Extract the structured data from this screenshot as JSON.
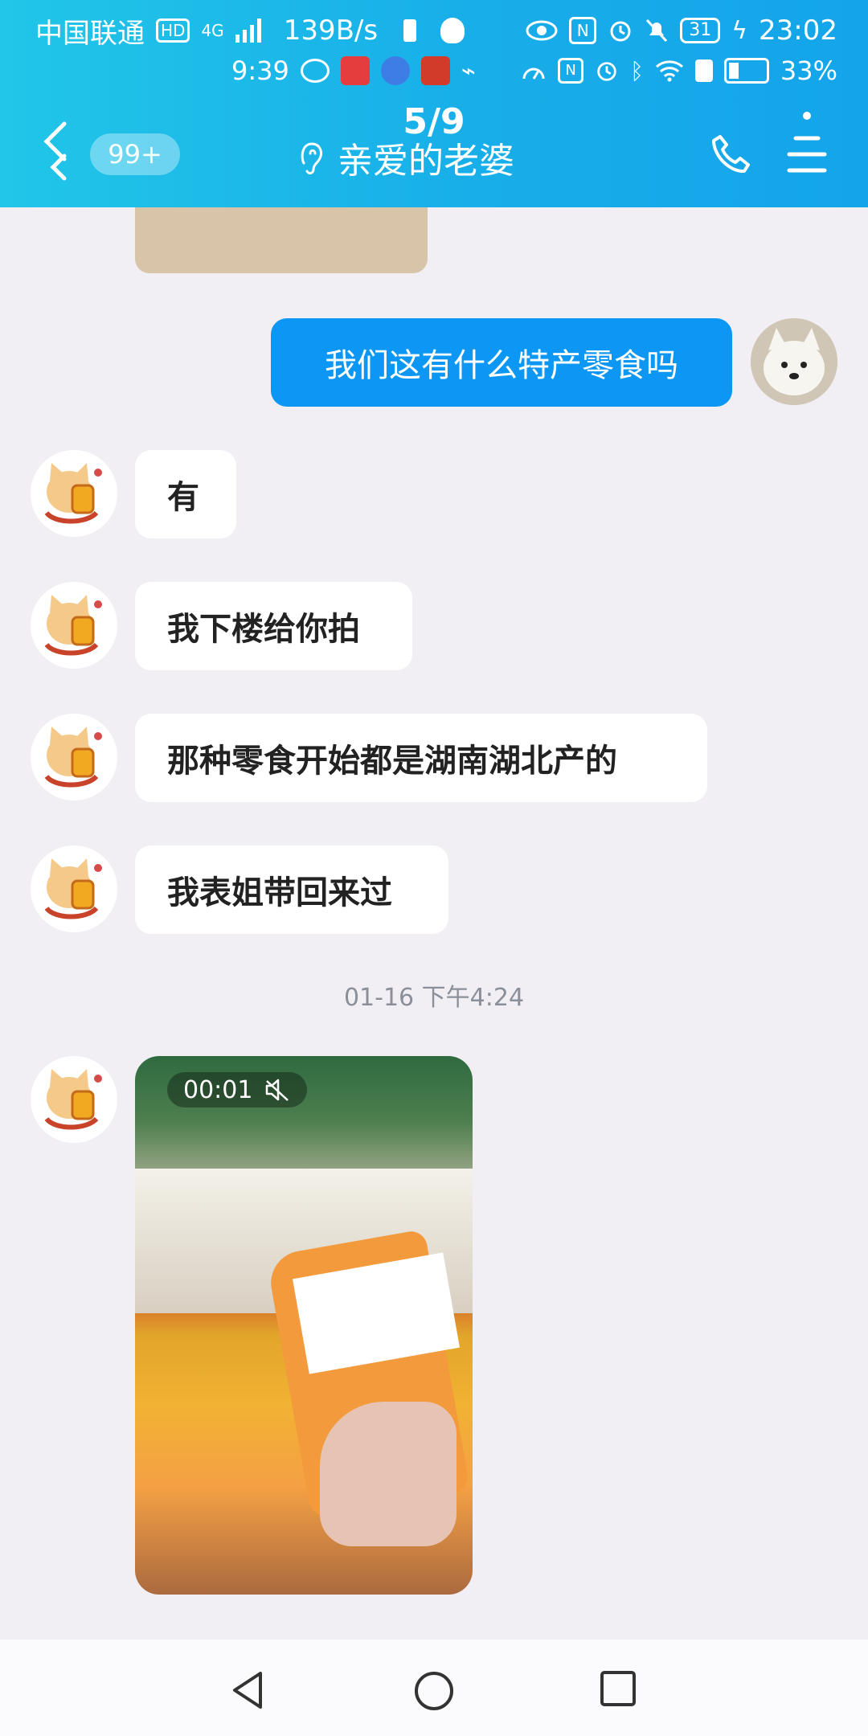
{
  "status_bar": {
    "carrier": "中国联通",
    "hd": "HD",
    "network": "4G",
    "speed": "139B/s",
    "battery_box_number": "31",
    "time": "23:02",
    "time_secondary": "9:39",
    "battery_percent": "33%"
  },
  "nav": {
    "unread_badge": "99+",
    "image_counter": "5/9",
    "title": "亲爱的老婆"
  },
  "messages": [
    {
      "side": "out",
      "text": "我们这有什么特产零食吗"
    },
    {
      "side": "in",
      "text": "有"
    },
    {
      "side": "in",
      "text": "我下楼给你拍"
    },
    {
      "side": "in",
      "text": "那种零食开始都是湖南湖北产的"
    },
    {
      "side": "in",
      "text": "我表姐带回来过"
    }
  ],
  "timestamp": "01-16 下午4:24",
  "video": {
    "duration": "00:01"
  },
  "colors": {
    "header_start": "#21c6e8",
    "header_end": "#14a4ea",
    "outgoing_bubble": "#0b97f3",
    "background": "#f1eff3"
  },
  "icons": [
    "back-icon",
    "ear-icon",
    "phone-icon",
    "menu-icon",
    "mute-icon",
    "nav-back-icon",
    "nav-home-icon",
    "nav-recents-icon"
  ]
}
